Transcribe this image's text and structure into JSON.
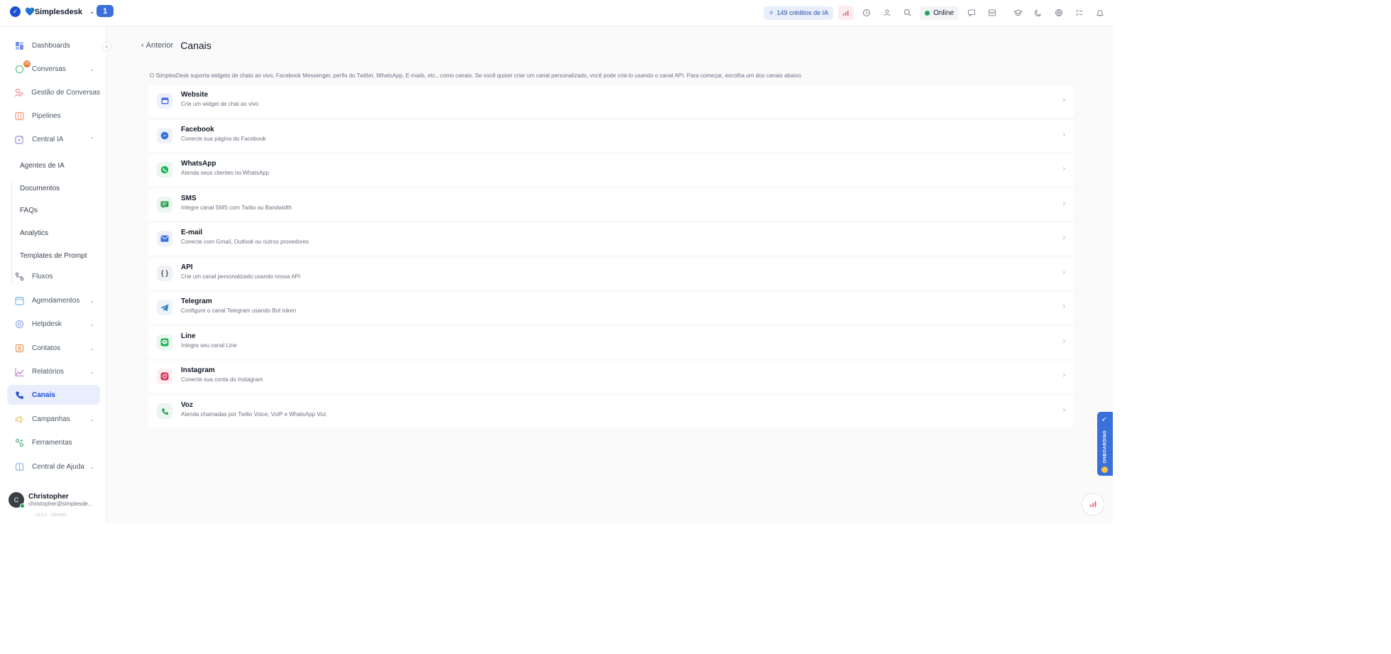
{
  "topbar": {
    "brand_name": "💙Simplesdesk",
    "notification_count": "1",
    "credits_label": "149 créditos de IA",
    "status_label": "Online"
  },
  "sidebar": {
    "items": [
      {
        "label": "Dashboards",
        "icon": "dashboard-icon"
      },
      {
        "label": "Conversas",
        "icon": "chat-icon",
        "badge": "58",
        "chevron": "down"
      },
      {
        "label": "Gestão de Conversas",
        "icon": "conversation-management-icon"
      },
      {
        "label": "Pipelines",
        "icon": "pipeline-icon"
      },
      {
        "label": "Central IA",
        "icon": "ai-icon",
        "chevron": "up"
      },
      {
        "label": "Fluxos",
        "icon": "flow-icon"
      },
      {
        "label": "Agendamentos",
        "icon": "calendar-icon",
        "chevron": "down"
      },
      {
        "label": "Helpdesk",
        "icon": "helpdesk-icon",
        "chevron": "down"
      },
      {
        "label": "Contatos",
        "icon": "contacts-icon",
        "chevron": "down"
      },
      {
        "label": "Relatórios",
        "icon": "reports-icon",
        "chevron": "down"
      },
      {
        "label": "Canais",
        "icon": "phone-icon",
        "active": true
      },
      {
        "label": "Campanhas",
        "icon": "megaphone-icon",
        "chevron": "down"
      },
      {
        "label": "Ferramentas",
        "icon": "tools-icon"
      },
      {
        "label": "Central de Ajuda",
        "icon": "help-center-icon",
        "chevron": "down"
      }
    ],
    "sub_items": [
      "Agentes de IA",
      "Documentos",
      "FAQs",
      "Analytics",
      "Templates de Prompt"
    ],
    "user": {
      "name": "Christopher",
      "email": "christopher@simplesde...",
      "version": "v4.0.1 · 1f40460"
    }
  },
  "main": {
    "back_label": "Anterior",
    "title": "Canais",
    "intro": "O SimplesDesk suporta widgets de chats ao vivo, Facebook Messenger, perfis do Twitter, WhatsApp, E-mails, etc., como canais. Se você quiser criar um canal personalizado, você pode criá-lo usando o canal API. Para começar, escolha um dos canais abaixo.",
    "channels": [
      {
        "title": "Website",
        "desc": "Crie um widget de chat ao vivo",
        "icon": "website-icon",
        "color": "#4f6fe0",
        "bg": "#eef1fc"
      },
      {
        "title": "Facebook",
        "desc": "Conecte sua página do Facebook",
        "icon": "messenger-icon",
        "color": "#3b6fd9",
        "bg": "#eef2fb"
      },
      {
        "title": "WhatsApp",
        "desc": "Atenda seus clientes no WhatsApp",
        "icon": "whatsapp-icon",
        "color": "#22b35a",
        "bg": "#eaf7ef"
      },
      {
        "title": "SMS",
        "desc": "Integre canal SMS com Twilio ou Bandwidth",
        "icon": "sms-icon",
        "color": "#2e9e52",
        "bg": "#eaf6ee"
      },
      {
        "title": "E-mail",
        "desc": "Conecte com Gmail, Outlook ou outros provedores",
        "icon": "email-icon",
        "color": "#3b6fd9",
        "bg": "#eef2fb"
      },
      {
        "title": "API",
        "desc": "Crie um canal personalizado usando nossa API",
        "icon": "api-icon",
        "color": "#6b7280",
        "bg": "#f1f2f4"
      },
      {
        "title": "Telegram",
        "desc": "Configure o canal Telegram usando Bot token",
        "icon": "telegram-icon",
        "color": "#2f7ec8",
        "bg": "#edf4fb"
      },
      {
        "title": "Line",
        "desc": "Integre seu canal Line",
        "icon": "line-icon",
        "color": "#22b35a",
        "bg": "#eaf7ef"
      },
      {
        "title": "Instagram",
        "desc": "Conecte sua conta do Instagram",
        "icon": "instagram-icon",
        "color": "#d6355a",
        "bg": "#fcedf1"
      },
      {
        "title": "Voz",
        "desc": "Atenda chamadas por Twilio Voice, VoIP e WhatsApp Voz",
        "icon": "voice-icon",
        "color": "#2e9e52",
        "bg": "#eaf6ee"
      }
    ]
  },
  "onboarding_label": "ONBOARDING"
}
